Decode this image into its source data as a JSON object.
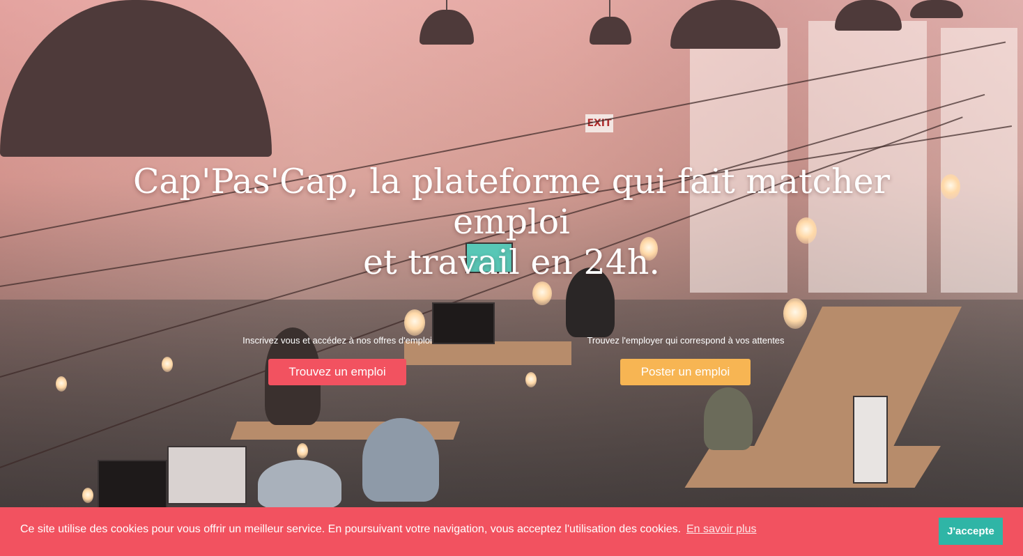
{
  "hero": {
    "headline_line1": "Cap'Pas'Cap, la plateforme qui fait matcher emploi",
    "headline_line2": "et travail en 24h.",
    "exit_sign": "EXIT"
  },
  "cta": {
    "candidate_caption": "Inscrivez vous et accédez à nos offres d'emploi",
    "candidate_button": "Trouvez un emploi",
    "employer_caption": "Trouvez l'employer qui correspond à vos attentes",
    "employer_button": "Poster un emploi"
  },
  "cookie_banner": {
    "message": "Ce site utilise des cookies pour vous offrir un meilleur service. En poursuivant votre navigation, vous acceptez l'utilisation des cookies.",
    "learn_more": "En savoir plus",
    "accept": "J'accepte"
  },
  "colors": {
    "primary_red": "#f25260",
    "accent_orange": "#f7b553",
    "accept_teal": "#2fb5a6"
  }
}
